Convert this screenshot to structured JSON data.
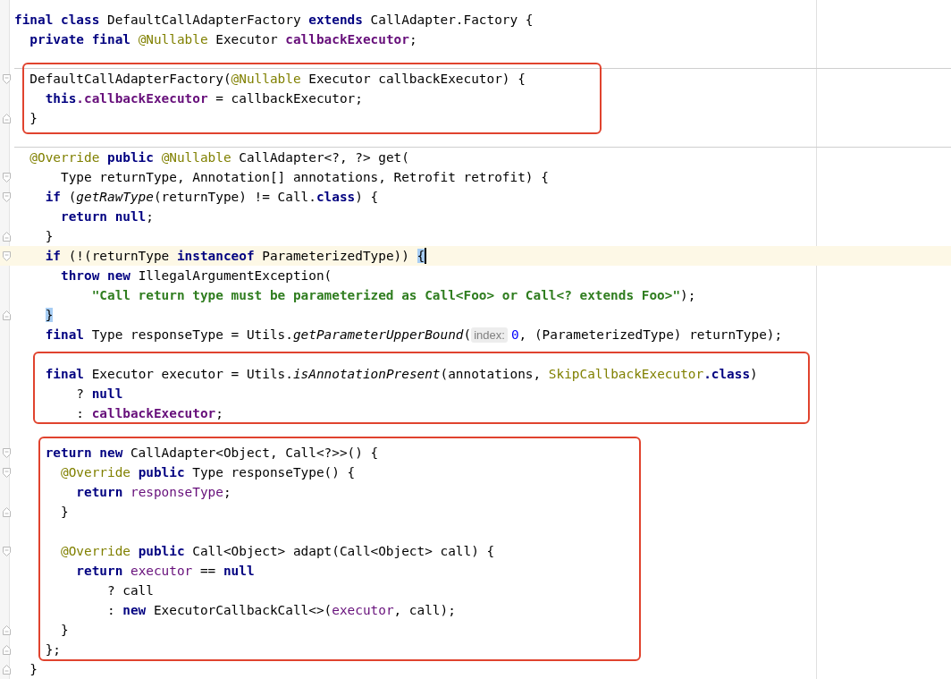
{
  "editor": {
    "blocks": [
      {
        "lines": [
          {
            "kind": "code",
            "tokens": [
              {
                "kind": "keyword",
                "text": "final class"
              },
              {
                "kind": "plain",
                "text": " DefaultCallAdapterFactory "
              },
              {
                "kind": "keyword",
                "text": "extends"
              },
              {
                "kind": "plain",
                "text": " CallAdapter.Factory {"
              }
            ]
          },
          {
            "kind": "code",
            "tokens": [
              {
                "kind": "keyword",
                "text": "  private final "
              },
              {
                "kind": "annotation",
                "text": "@Nullable"
              },
              {
                "kind": "plain",
                "text": " Executor "
              },
              {
                "kind": "field",
                "text": "callbackExecutor"
              },
              {
                "kind": "plain",
                "text": ";"
              }
            ]
          },
          {
            "kind": "blank",
            "separator": true
          }
        ]
      },
      {
        "boxed": true,
        "lines": [
          {
            "kind": "code",
            "fold_start": true,
            "tokens": [
              {
                "kind": "plain",
                "text": "  DefaultCallAdapterFactory("
              },
              {
                "kind": "annotation",
                "text": "@Nullable"
              },
              {
                "kind": "plain",
                "text": " Executor callbackExecutor) {"
              }
            ]
          },
          {
            "kind": "code",
            "tokens": [
              {
                "kind": "keyword",
                "text": "    this"
              },
              {
                "kind": "field",
                "text": ".callbackExecutor"
              },
              {
                "kind": "plain",
                "text": " = callbackExecutor;"
              }
            ]
          },
          {
            "kind": "code",
            "fold_end": true,
            "tokens": [
              {
                "kind": "plain",
                "text": "  }"
              }
            ]
          }
        ]
      },
      {
        "lines": [
          {
            "kind": "blank",
            "separator": true
          },
          {
            "kind": "code",
            "tokens": [
              {
                "kind": "annotation",
                "text": "  @Override "
              },
              {
                "kind": "keyword",
                "text": "public "
              },
              {
                "kind": "annotation",
                "text": "@Nullable"
              },
              {
                "kind": "plain",
                "text": " CallAdapter<?, ?> get("
              }
            ]
          },
          {
            "kind": "code",
            "fold_start": true,
            "tokens": [
              {
                "kind": "plain",
                "text": "      Type returnType, Annotation[] annotations, Retrofit retrofit) {"
              }
            ]
          },
          {
            "kind": "code",
            "fold_start": true,
            "tokens": [
              {
                "kind": "keyword",
                "text": "    if"
              },
              {
                "kind": "plain",
                "text": " ("
              },
              {
                "kind": "static_call",
                "text": "getRawType"
              },
              {
                "kind": "plain",
                "text": "(returnType) != Call."
              },
              {
                "kind": "keyword",
                "text": "class"
              },
              {
                "kind": "plain",
                "text": ") {"
              }
            ]
          },
          {
            "kind": "code",
            "tokens": [
              {
                "kind": "keyword",
                "text": "      return null"
              },
              {
                "kind": "plain",
                "text": ";"
              }
            ]
          },
          {
            "kind": "code",
            "fold_end": true,
            "tokens": [
              {
                "kind": "plain",
                "text": "    }"
              }
            ]
          },
          {
            "kind": "code",
            "fold_start": true,
            "current": true,
            "caret": true,
            "tokens": [
              {
                "kind": "keyword",
                "text": "    if"
              },
              {
                "kind": "plain",
                "text": " (!(returnType "
              },
              {
                "kind": "keyword",
                "text": "instanceof"
              },
              {
                "kind": "plain",
                "text": " ParameterizedType)) "
              },
              {
                "kind": "brace_match",
                "text": "{"
              }
            ]
          },
          {
            "kind": "code",
            "tokens": [
              {
                "kind": "keyword",
                "text": "      throw new"
              },
              {
                "kind": "plain",
                "text": " IllegalArgumentException("
              }
            ]
          },
          {
            "kind": "code",
            "tokens": [
              {
                "kind": "string",
                "text": "          \"Call return type must be parameterized as Call<Foo> or Call<? extends Foo>\""
              },
              {
                "kind": "plain",
                "text": ");"
              }
            ]
          },
          {
            "kind": "code",
            "fold_end": true,
            "tokens": [
              {
                "kind": "brace_match",
                "text": "    }"
              }
            ]
          },
          {
            "kind": "code",
            "tokens": [
              {
                "kind": "keyword",
                "text": "    final"
              },
              {
                "kind": "plain",
                "text": " Type responseType = Utils."
              },
              {
                "kind": "static_call",
                "text": "getParameterUpperBound"
              },
              {
                "kind": "plain",
                "text": "("
              },
              {
                "kind": "hint",
                "text": "index:"
              },
              {
                "kind": "number",
                "text": "0"
              },
              {
                "kind": "plain",
                "text": ", (ParameterizedType) returnType);"
              }
            ]
          },
          {
            "kind": "blank"
          }
        ]
      },
      {
        "boxed": true,
        "lines": [
          {
            "kind": "code",
            "tokens": [
              {
                "kind": "keyword",
                "text": "    final"
              },
              {
                "kind": "plain",
                "text": " Executor executor = Utils."
              },
              {
                "kind": "static_call",
                "text": "isAnnotationPresent"
              },
              {
                "kind": "plain",
                "text": "(annotations, "
              },
              {
                "kind": "annotation",
                "text": "SkipCallbackExecutor"
              },
              {
                "kind": "keyword",
                "text": ".class"
              },
              {
                "kind": "plain",
                "text": ")"
              }
            ]
          },
          {
            "kind": "code",
            "tokens": [
              {
                "kind": "plain",
                "text": "        ? "
              },
              {
                "kind": "keyword",
                "text": "null"
              }
            ]
          },
          {
            "kind": "code",
            "tokens": [
              {
                "kind": "plain",
                "text": "        : "
              },
              {
                "kind": "field",
                "text": "callbackExecutor"
              },
              {
                "kind": "plain",
                "text": ";"
              }
            ]
          }
        ]
      },
      {
        "lines": [
          {
            "kind": "blank"
          }
        ]
      },
      {
        "boxed": true,
        "lines": [
          {
            "kind": "code",
            "fold_start": true,
            "tokens": [
              {
                "kind": "keyword",
                "text": "    return new"
              },
              {
                "kind": "plain",
                "text": " CallAdapter<Object, Call<?>>() {"
              }
            ]
          },
          {
            "kind": "code",
            "fold_start": true,
            "tokens": [
              {
                "kind": "annotation",
                "text": "      @Override "
              },
              {
                "kind": "keyword",
                "text": "public"
              },
              {
                "kind": "plain",
                "text": " Type responseType() {"
              }
            ]
          },
          {
            "kind": "code",
            "tokens": [
              {
                "kind": "keyword",
                "text": "        return "
              },
              {
                "kind": "variable",
                "text": "responseType"
              },
              {
                "kind": "plain",
                "text": ";"
              }
            ]
          },
          {
            "kind": "code",
            "fold_end": true,
            "tokens": [
              {
                "kind": "plain",
                "text": "      }"
              }
            ]
          },
          {
            "kind": "blank"
          },
          {
            "kind": "code",
            "fold_start": true,
            "tokens": [
              {
                "kind": "annotation",
                "text": "      @Override "
              },
              {
                "kind": "keyword",
                "text": "public"
              },
              {
                "kind": "plain",
                "text": " Call<Object> adapt(Call<Object> call) {"
              }
            ]
          },
          {
            "kind": "code",
            "tokens": [
              {
                "kind": "keyword",
                "text": "        return "
              },
              {
                "kind": "variable",
                "text": "executor"
              },
              {
                "kind": "plain",
                "text": " == "
              },
              {
                "kind": "keyword",
                "text": "null"
              }
            ]
          },
          {
            "kind": "code",
            "tokens": [
              {
                "kind": "plain",
                "text": "            ? call"
              }
            ]
          },
          {
            "kind": "code",
            "tokens": [
              {
                "kind": "plain",
                "text": "            : "
              },
              {
                "kind": "keyword",
                "text": "new"
              },
              {
                "kind": "plain",
                "text": " ExecutorCallbackCall<>("
              },
              {
                "kind": "variable",
                "text": "executor"
              },
              {
                "kind": "plain",
                "text": ", call);"
              }
            ]
          },
          {
            "kind": "code",
            "fold_end": true,
            "tokens": [
              {
                "kind": "plain",
                "text": "      }"
              }
            ]
          },
          {
            "kind": "code",
            "fold_end": true,
            "tokens": [
              {
                "kind": "plain",
                "text": "    };"
              }
            ]
          }
        ]
      },
      {
        "lines": [
          {
            "kind": "code",
            "fold_end": true,
            "tokens": [
              {
                "kind": "plain",
                "text": "  }"
              }
            ]
          }
        ]
      }
    ]
  }
}
